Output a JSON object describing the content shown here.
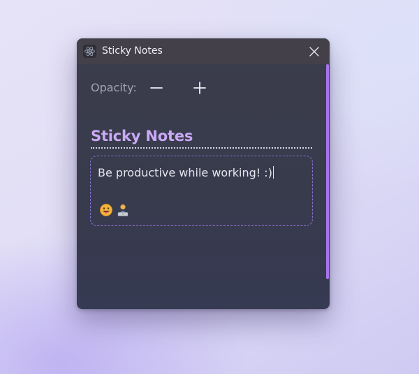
{
  "window": {
    "title": "Sticky Notes",
    "app_icon": "atom-icon",
    "close_icon": "close-icon"
  },
  "toolbar": {
    "opacity_label": "Opacity:",
    "decrease_icon": "minus-icon",
    "increase_icon": "plus-icon"
  },
  "note": {
    "title": "Sticky Notes",
    "body": "Be productive while working! :)",
    "emojis": [
      "grinning-face-with-tongue-icon",
      "technologist-icon"
    ]
  },
  "colors": {
    "accent": "#a773ec",
    "title_text": "#caa9f5",
    "window_bg": "#3a3d4d",
    "titlebar_bg": "#43404a",
    "note_border": "#8a6fd0"
  }
}
